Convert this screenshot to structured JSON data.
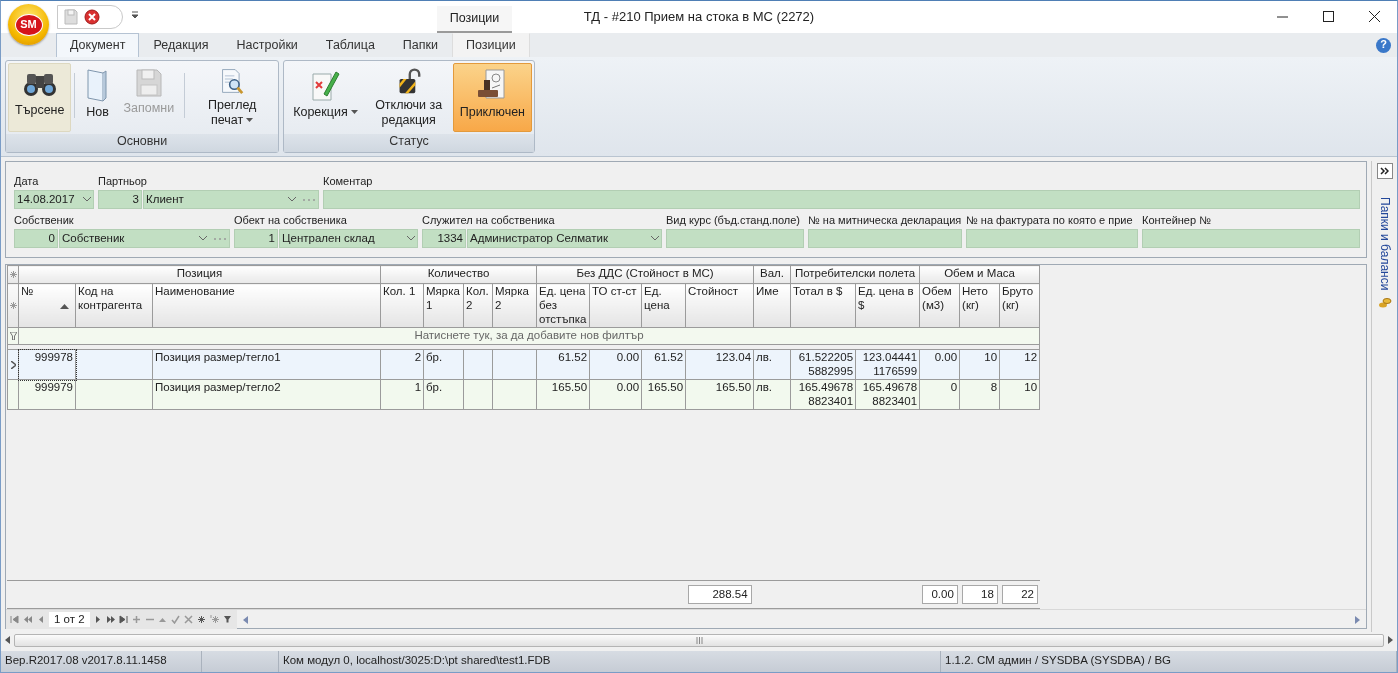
{
  "window": {
    "title": "ТД - #210 Прием на стока в МС (2272)",
    "logo": "SM",
    "context_group": "Позиции",
    "help": "?"
  },
  "ribbon_tabs": [
    {
      "label": "Документ",
      "selected": true,
      "contextual": false
    },
    {
      "label": "Редакция",
      "selected": false,
      "contextual": false
    },
    {
      "label": "Настройки",
      "selected": false,
      "contextual": false
    },
    {
      "label": "Таблица",
      "selected": false,
      "contextual": false
    },
    {
      "label": "Папки",
      "selected": false,
      "contextual": false
    },
    {
      "label": "Позиции",
      "selected": false,
      "contextual": true
    }
  ],
  "ribbon_groups": [
    {
      "title": "Основни",
      "buttons": [
        {
          "label": "Търсене",
          "hovered": true,
          "checked": false,
          "disabled": false,
          "dropdown": false
        },
        {
          "label": "Нов",
          "hovered": false,
          "checked": false,
          "disabled": false,
          "dropdown": false
        },
        {
          "label": "Запомни",
          "hovered": false,
          "checked": false,
          "disabled": true,
          "dropdown": false
        },
        {
          "label": "Преглед печат",
          "hovered": false,
          "checked": false,
          "disabled": false,
          "dropdown": true
        }
      ]
    },
    {
      "title": "Статус",
      "buttons": [
        {
          "label": "Корекция",
          "hovered": false,
          "checked": false,
          "disabled": false,
          "dropdown": true
        },
        {
          "label": "Отключи за редакция",
          "hovered": false,
          "checked": false,
          "disabled": false,
          "dropdown": false
        },
        {
          "label": "Приключен",
          "hovered": false,
          "checked": true,
          "disabled": false,
          "dropdown": false
        }
      ]
    }
  ],
  "form": {
    "fields": [
      {
        "kind": "date",
        "label": "Дата",
        "value": "14.08.2017"
      },
      {
        "kind": "lookup",
        "label": "Партньор",
        "code": "3",
        "value": "Клиент",
        "more": true
      },
      {
        "kind": "text",
        "label": "Коментар"
      },
      {
        "kind": "lookup",
        "label": "Собственик",
        "code": "0",
        "value": "Собственик",
        "more": true
      },
      {
        "kind": "lookup",
        "label": "Обект на собственика",
        "code": "1",
        "value": "Централен склад",
        "more": false
      },
      {
        "kind": "lookup",
        "label": "Служител на собственика",
        "code": "1334",
        "value": "Администратор Селматик",
        "more": false
      },
      {
        "kind": "text",
        "label": "Вид курс (бъд.станд.поле)"
      },
      {
        "kind": "text",
        "label": "№ на митническа декларация"
      },
      {
        "kind": "text",
        "label": "№ на фактурата по която е прие"
      },
      {
        "kind": "text",
        "label": "Контейнер №"
      }
    ]
  },
  "grid": {
    "bands": [
      "Позиция",
      "Количество",
      "Без ДДС (Стойност в МС)",
      "Вал.",
      "Потребителски полета",
      "Обем и Маса"
    ],
    "columns": [
      {
        "label": "№",
        "sorted": true
      },
      {
        "label": "Код на контрагента"
      },
      {
        "label": "Наименование"
      },
      {
        "label": "Кол. 1"
      },
      {
        "label": "Мярка 1"
      },
      {
        "label": "Кол. 2"
      },
      {
        "label": "Мярка 2"
      },
      {
        "label": "Ед. цена без отстъпка"
      },
      {
        "label": "ТО ст-ст"
      },
      {
        "label": "Ед. цена"
      },
      {
        "label": "Стойност",
        "total": "288.54"
      },
      {
        "label": "Име"
      },
      {
        "label": "Тотал в $"
      },
      {
        "label": "Ед. цена в $"
      },
      {
        "label": "Обем (м3)",
        "total": "0.00"
      },
      {
        "label": "Нето (кг)",
        "total": "18"
      },
      {
        "label": "Бруто (кг)",
        "total": "22"
      }
    ],
    "filter_hint": "Натиснете тук, за да добавите нов филтър",
    "rows": [
      {
        "selected": true,
        "cells": [
          "999978",
          null,
          "Позиция размер/тегло1",
          "2",
          "бр.",
          null,
          null,
          "61.52",
          "0.00",
          "61.52",
          "123.04",
          "лв.",
          "61.5222055882995",
          "123.044411176599",
          "0.00",
          "10",
          "12"
        ]
      },
      {
        "selected": false,
        "cells": [
          "999979",
          null,
          "Позиция размер/тегло2",
          "1",
          "бр.",
          null,
          null,
          "165.50",
          "0.00",
          "165.50",
          "165.50",
          "лв.",
          "165.496788823401",
          "165.496788823401",
          "0",
          "8",
          "10"
        ]
      }
    ]
  },
  "navigator": {
    "page": "1 от 2"
  },
  "side_panel": {
    "label": "Папки и баланси"
  },
  "status_bar": [
    "Вер.R2017.08 v2017.8.11.1458",
    "Ком модул 0, localhost/3025:D:\\pt shared\\test1.FDB",
    "1.1.2. СМ админ / SYSDBA (SYSDBA) / BG"
  ]
}
